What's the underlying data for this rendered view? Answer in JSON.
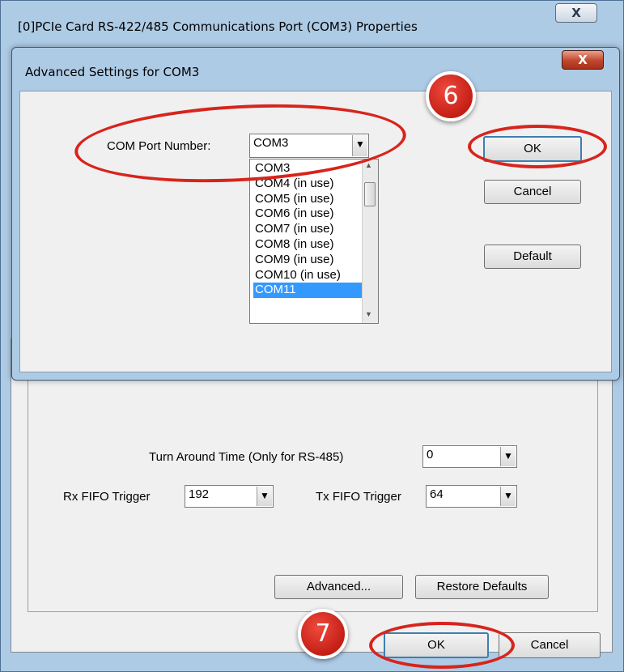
{
  "outer_window": {
    "title": "[0]PCIe Card RS-422/485 Communications Port (COM3) Properties",
    "close_glyph": "X",
    "turn_around_label": "Turn Around Time (Only for RS-485)",
    "turn_around_value": "0",
    "rx_fifo_label": "Rx FIFO Trigger",
    "rx_fifo_value": "192",
    "tx_fifo_label": "Tx FIFO Trigger",
    "tx_fifo_value": "64",
    "advanced_button": "Advanced...",
    "restore_defaults_button": "Restore Defaults",
    "ok_button": "OK",
    "cancel_button": "Cancel"
  },
  "advanced_dialog": {
    "title": "Advanced Settings for COM3",
    "close_glyph": "X",
    "com_port_label": "COM Port Number:",
    "com_port_value": "COM3",
    "com_port_options": [
      "COM3",
      "COM4 (in use)",
      "COM5 (in use)",
      "COM6 (in use)",
      "COM7 (in use)",
      "COM8 (in use)",
      "COM9 (in use)",
      "COM10 (in use)",
      "COM11"
    ],
    "selected_option": "COM11",
    "ok_button": "OK",
    "cancel_button": "Cancel",
    "default_button": "Default"
  },
  "annotations": {
    "step_6": "6",
    "step_7": "7",
    "highlight_color": "#d7241c"
  },
  "icons": {
    "dropdown_arrow": "▼",
    "scroll_up": "▲",
    "scroll_down": "▼"
  }
}
